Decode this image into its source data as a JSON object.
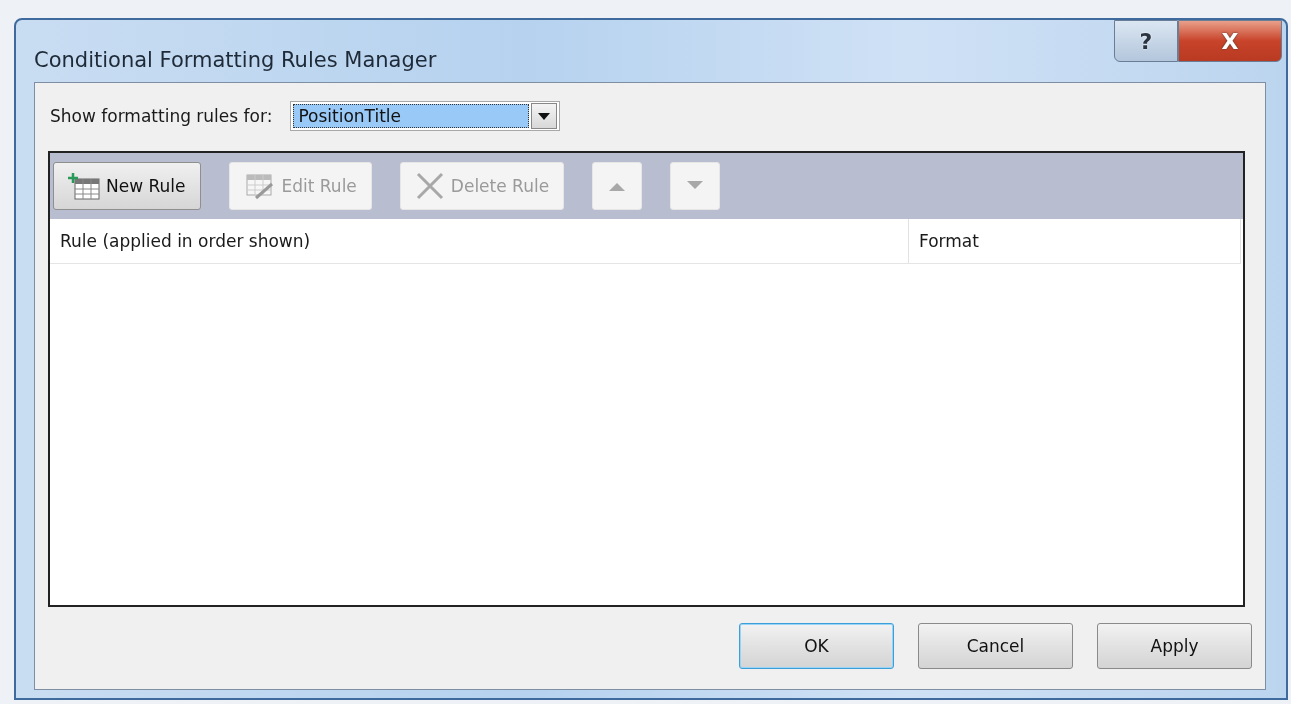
{
  "window": {
    "title": "Conditional Formatting Rules Manager",
    "help_button": "?",
    "close_button": "X"
  },
  "scope": {
    "label": "Show formatting rules for:",
    "value": "PositionTitle"
  },
  "toolbar": [
    {
      "kind": "text",
      "label": "New Rule",
      "disabled": false
    },
    {
      "kind": "text",
      "label": "Edit Rule",
      "disabled": true
    },
    {
      "kind": "text",
      "label": "Delete Rule",
      "disabled": true
    },
    {
      "kind": "arrow",
      "disabled": true
    },
    {
      "kind": "arrow",
      "disabled": true
    }
  ],
  "table": {
    "columns": [
      "Rule (applied in order shown)",
      "Format"
    ]
  },
  "buttons": [
    {
      "label": "OK",
      "default": true
    },
    {
      "label": "Cancel",
      "default": false
    },
    {
      "label": "Apply",
      "default": false
    }
  ]
}
